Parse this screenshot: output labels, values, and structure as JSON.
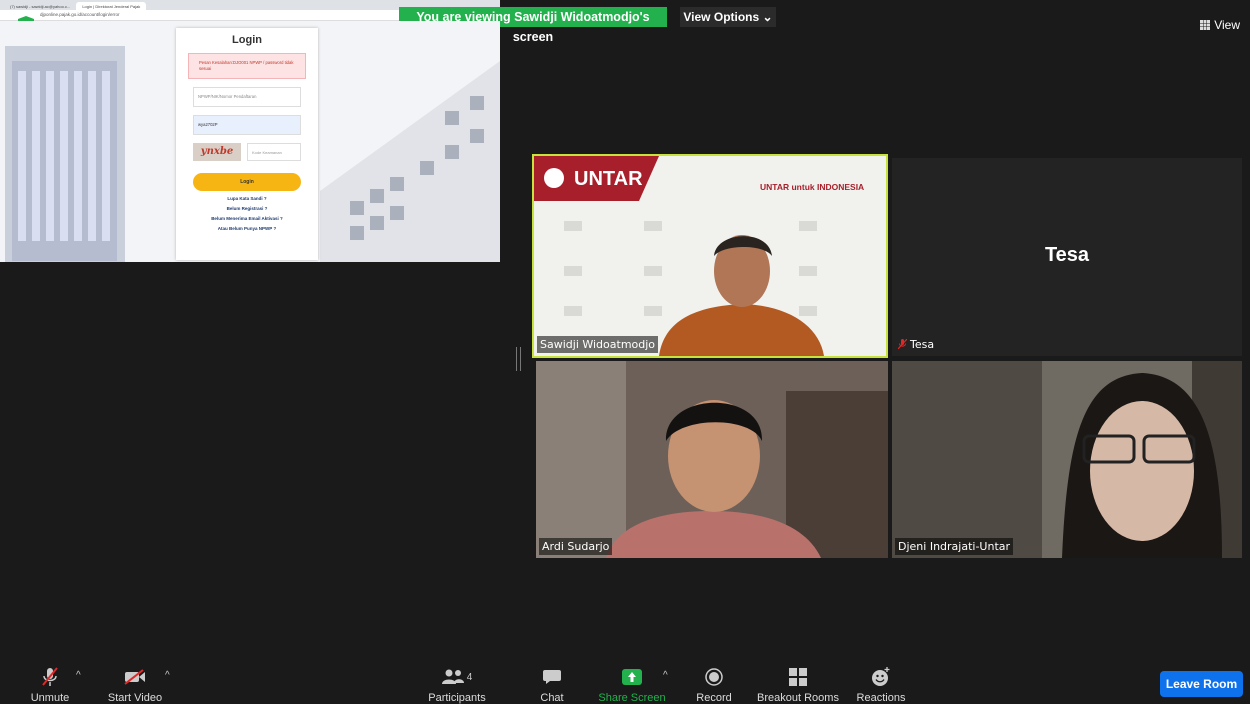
{
  "top": {
    "viewing_banner": "You are viewing Sawidji Widoatmodjo's screen",
    "view_options": "View Options",
    "view_label": "View"
  },
  "shared_screen": {
    "tabs": [
      "(7) sawidji - sawidji.ac@yahoo.c...",
      "Login | Direktorat Jenderal Pajak"
    ],
    "url": "djponline.pajak.go.id/account/login/error",
    "login_title": "Login",
    "error_text": "Pesan Kesalahan:DJO001 NPWP / password tidak sesuai",
    "npwp_placeholder": "NPWP/NIK/Nomor Pendaftaran",
    "password_value": "wya2702P",
    "captcha_text": "ynxbe",
    "captcha_placeholder": "Kode Keamanan",
    "login_button": "Login",
    "links": [
      "Lupa Kata Sandi ?",
      "Belum Registrasi ?",
      "Belum Menerima Email Aktivasi ?",
      "Atau Belum Punya NPWP ?"
    ]
  },
  "tiles": {
    "sawidji": {
      "name": "Sawidji Widoatmodjo",
      "brand": "UNTAR",
      "slogan": "UNTAR untuk INDONESIA"
    },
    "tesa": {
      "name": "Tesa",
      "display": "Tesa"
    },
    "ardi": {
      "name": "Ardi Sudarjo"
    },
    "djeni": {
      "name": "Djeni Indrajati-Untar"
    }
  },
  "toolbar": {
    "unmute": "Unmute",
    "start_video": "Start Video",
    "participants": "Participants",
    "participants_count": "4",
    "chat": "Chat",
    "share_screen": "Share Screen",
    "record": "Record",
    "breakout": "Breakout Rooms",
    "reactions": "Reactions",
    "leave": "Leave Room"
  },
  "colors": {
    "accent_green": "#22b14c",
    "leave_blue": "#0e72ed",
    "speaker_border": "#c7e23d"
  }
}
